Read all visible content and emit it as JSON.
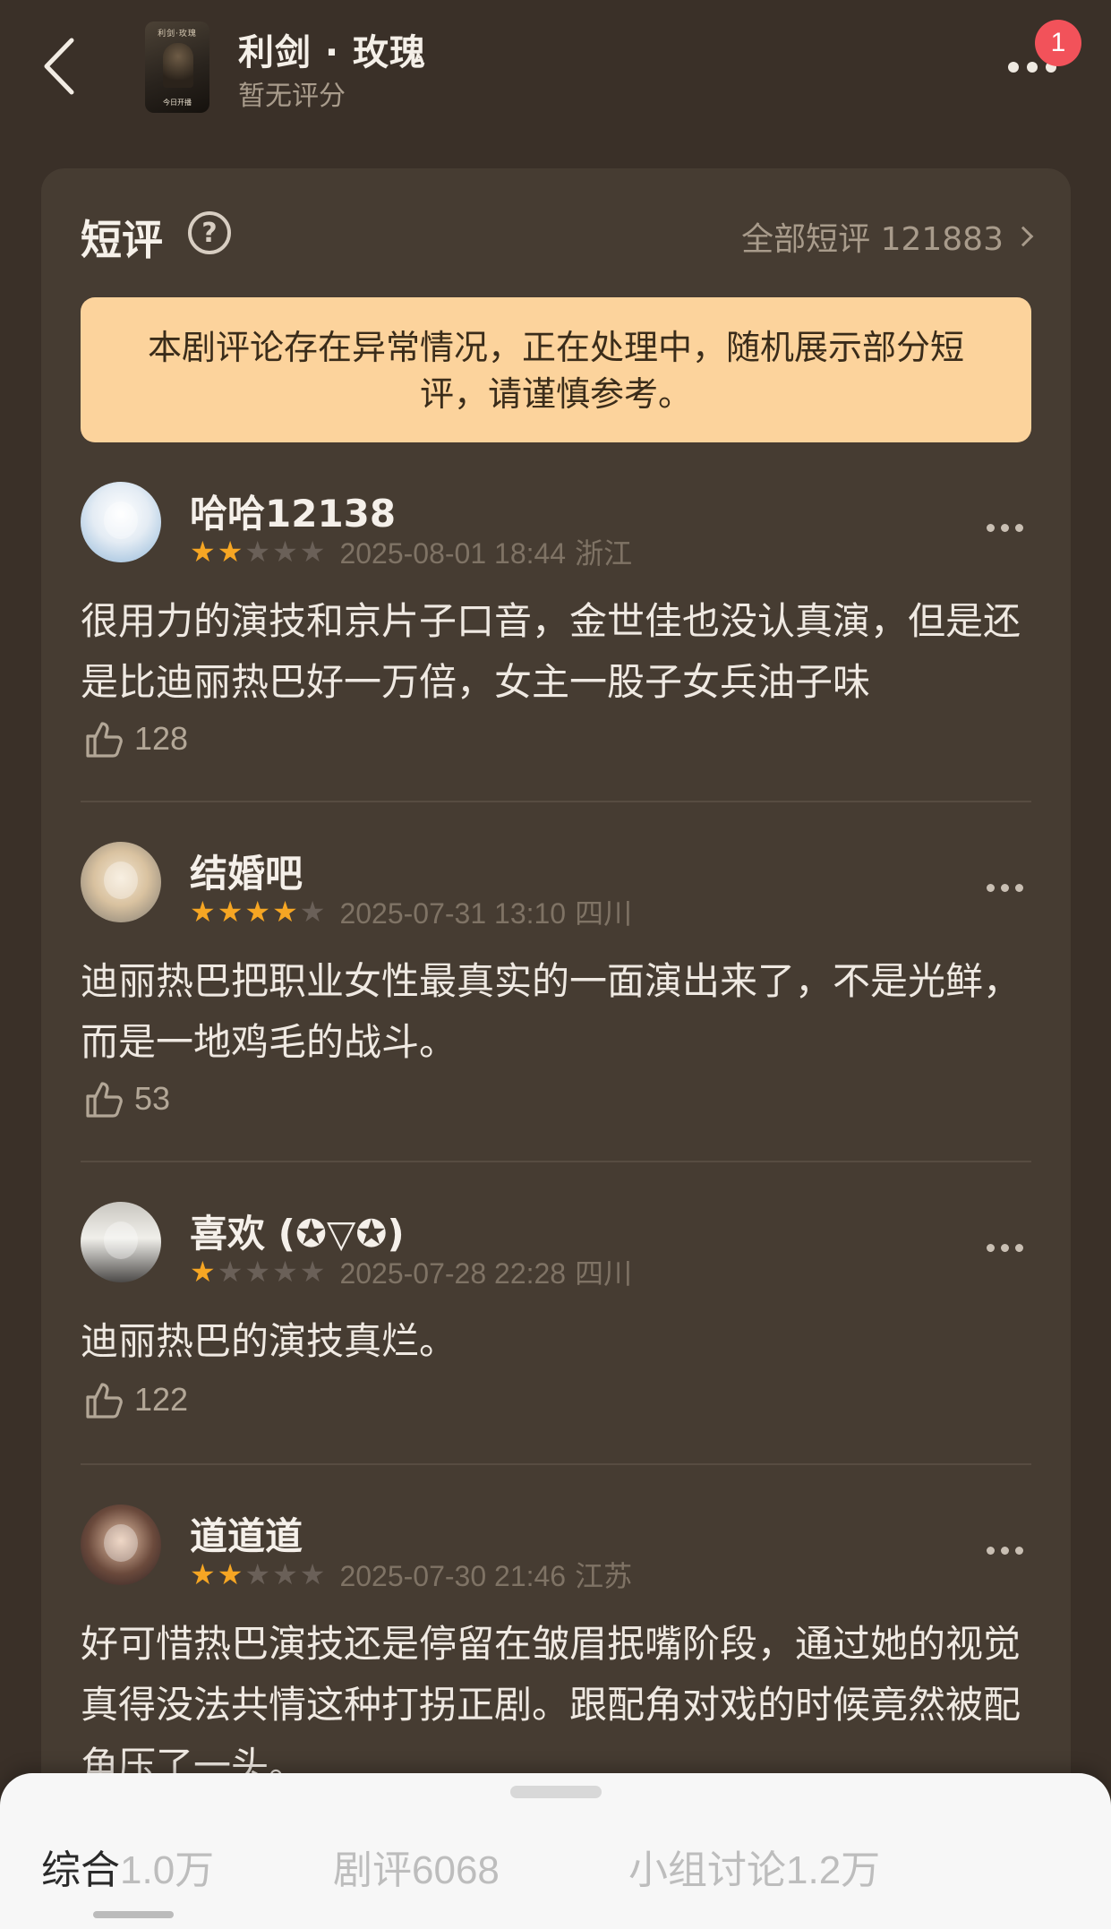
{
  "header": {
    "title": "利剑 · 玫瑰",
    "subtitle": "暂无评分",
    "notification_count": "1",
    "poster": {
      "title_text": "利剑·玫瑰",
      "footer_text": "今日开播"
    }
  },
  "section": {
    "title": "短评",
    "all_link": "全部短评 121883"
  },
  "notice": "本剧评论存在异常情况，正在处理中，随机展示部分短评，请谨慎参考。",
  "comments": [
    {
      "user": "哈哈12138",
      "rating": 2,
      "datetime": "2025-08-01 18:44",
      "location": "浙江",
      "text": "很用力的演技和京片子口音，金世佳也没认真演，但是还是比迪丽热巴好一万倍，女主一股子女兵油子味",
      "likes": "128"
    },
    {
      "user": "结婚吧",
      "rating": 4,
      "datetime": "2025-07-31 13:10",
      "location": "四川",
      "text": "迪丽热巴把职业女性最真实的一面演出来了，不是光鲜，而是一地鸡毛的战斗。",
      "likes": "53"
    },
    {
      "user": "喜欢 (✪▽✪)",
      "rating": 1,
      "datetime": "2025-07-28 22:28",
      "location": "四川",
      "text": "迪丽热巴的演技真烂。",
      "likes": "122"
    },
    {
      "user": "道道道",
      "rating": 2,
      "datetime": "2025-07-30 21:46",
      "location": "江苏",
      "text": "好可惜热巴演技还是停留在皱眉抿嘴阶段，通过她的视觉真得没法共情这种打拐正剧。跟配角对戏的时候竟然被配角压了一头。",
      "likes": ""
    }
  ],
  "tabs": [
    {
      "label": "综合",
      "count": "1.0万",
      "active": true
    },
    {
      "label": "剧评",
      "count": "6068",
      "active": false
    },
    {
      "label": "小组讨论",
      "count": "1.2万",
      "active": false
    }
  ],
  "colors": {
    "background": "#3a3028",
    "card": "#463c32",
    "notice_bg": "#fcd39c",
    "star_on": "#f6a623",
    "badge": "#f2525a"
  },
  "icons": [
    "back-arrow-icon",
    "more-dots-icon",
    "help-icon",
    "chevron-right-icon",
    "star-icon",
    "thumbs-up-icon"
  ]
}
